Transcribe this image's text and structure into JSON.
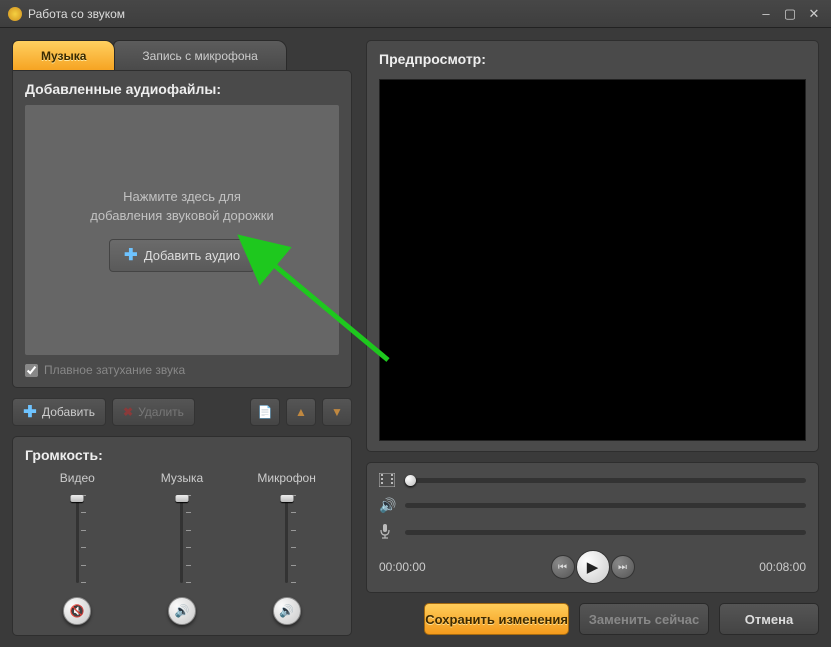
{
  "window": {
    "title": "Работа со звуком"
  },
  "tabs": {
    "music": "Музыка",
    "mic": "Запись с микрофона"
  },
  "files_panel": {
    "title": "Добавленные аудиофайлы:",
    "hint_line1": "Нажмите здесь для",
    "hint_line2": "добавления звуковой дорожки",
    "add_btn": "Добавить аудио",
    "fade_label": "Плавное затухание звука",
    "fade_checked": true
  },
  "rowbtns": {
    "add": "Добавить",
    "delete": "Удалить"
  },
  "volume": {
    "title": "Громкость:",
    "video": "Видео",
    "music": "Музыка",
    "mic": "Микрофон"
  },
  "preview": {
    "title": "Предпросмотр:"
  },
  "timeline": {
    "start": "00:00:00",
    "end": "00:08:00"
  },
  "footer": {
    "save": "Сохранить изменения",
    "replace": "Заменить сейчас",
    "cancel": "Отмена"
  }
}
